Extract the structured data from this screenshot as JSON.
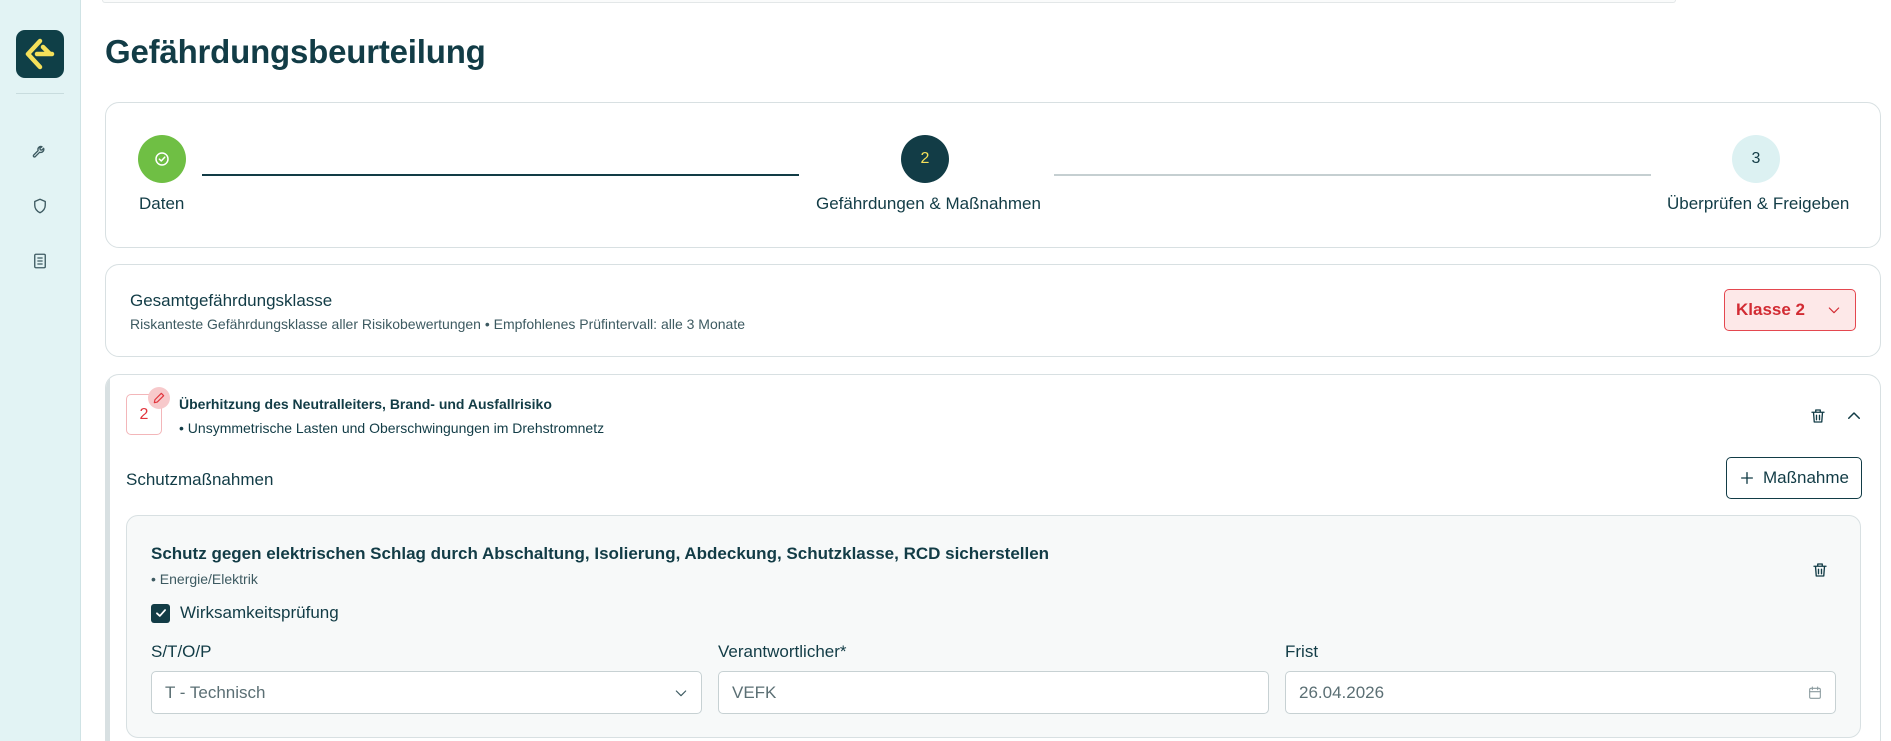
{
  "page": {
    "title": "Gefährdungsbeurteilung"
  },
  "sidebar": {
    "logo": "app-logo",
    "items": [
      {
        "icon": "wrench-icon"
      },
      {
        "icon": "shield-icon"
      },
      {
        "icon": "document-icon"
      }
    ]
  },
  "stepper": {
    "steps": [
      {
        "number": "",
        "label": "Daten",
        "state": "done"
      },
      {
        "number": "2",
        "label": "Gefährdungen & Maßnahmen",
        "state": "active"
      },
      {
        "number": "3",
        "label": "Überprüfen & Freigeben",
        "state": "pending"
      }
    ]
  },
  "overall_class": {
    "title": "Gesamtgefährdungsklasse",
    "subtitle": "Riskanteste Gefährdungsklasse aller Risikobewertungen • Empfohlenes Prüfintervall: alle 3 Monate",
    "selected": "Klasse 2"
  },
  "hazard": {
    "badge": "2",
    "title": "Überhitzung des Neutralleiters, Brand- und Ausfallrisiko",
    "cause": "• Unsymmetrische Lasten und Oberschwingungen im Drehstromnetz",
    "measures_label": "Schutzmaßnahmen",
    "add_measure_label": "Maßnahme"
  },
  "measure": {
    "title": "Schutz gegen elektrischen Schlag durch Abschaltung, Isolierung, Abdeckung, Schutzklasse, RCD sicherstellen",
    "category": "• Energie/Elektrik",
    "effectiveness_check": {
      "label": "Wirksamkeitsprüfung",
      "checked": true
    },
    "fields": {
      "stop": {
        "label": "S/T/O/P",
        "value": "T - Technisch"
      },
      "responsible": {
        "label": "Verantwortlicher*",
        "value": "VEFK"
      },
      "deadline": {
        "label": "Frist",
        "value": "26.04.2026"
      }
    }
  },
  "colors": {
    "primary": "#123c46",
    "success": "#6fbf44",
    "danger": "#e1343c",
    "sidebar_bg": "#e2f3f4",
    "accent_yellow": "#f4e05a"
  }
}
